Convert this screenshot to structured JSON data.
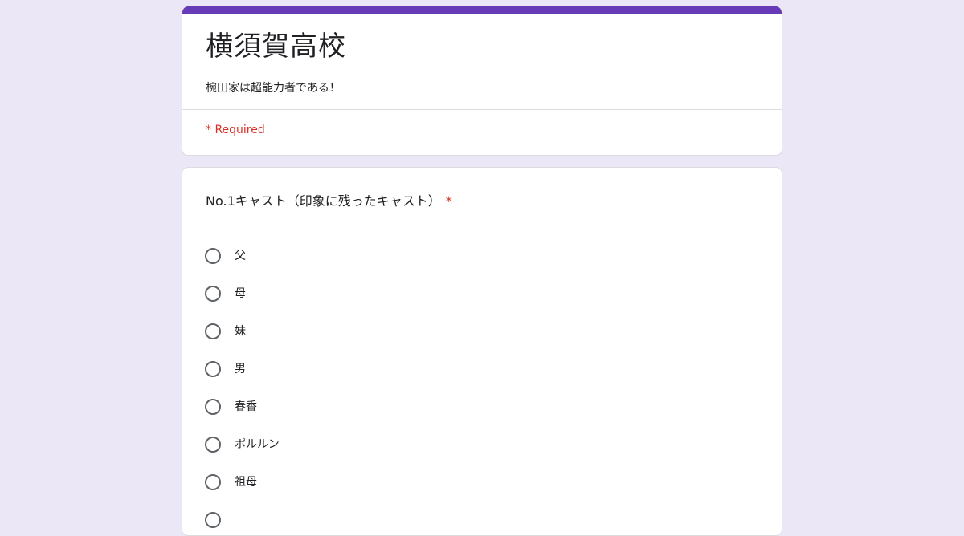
{
  "form": {
    "title": "横須賀高校",
    "description": "椀田家は超能力者である！",
    "required_note": "* Required",
    "accent_color": "#673ab7",
    "background_color": "#ece7f7"
  },
  "question": {
    "title": "No.1キャスト（印象に残ったキャスト）",
    "required_marker": "*",
    "options": [
      {
        "label": "父"
      },
      {
        "label": "母"
      },
      {
        "label": "妹"
      },
      {
        "label": "男"
      },
      {
        "label": "春香"
      },
      {
        "label": "ポルルン"
      },
      {
        "label": "祖母"
      },
      {
        "label": ""
      }
    ]
  }
}
